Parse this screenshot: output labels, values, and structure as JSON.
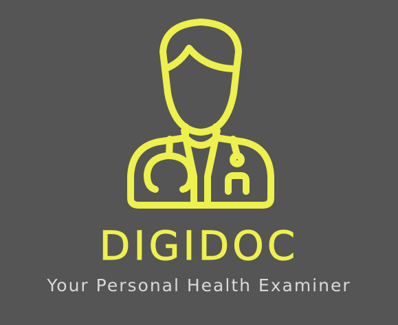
{
  "logo": {
    "icon": "doctor-with-stethoscope-icon",
    "brand_name": "DIGIDOC",
    "tagline": "Your Personal Health Examiner"
  },
  "colors": {
    "background": "#555555",
    "brand": "#eef04c",
    "tagline": "#d9d9d9"
  }
}
